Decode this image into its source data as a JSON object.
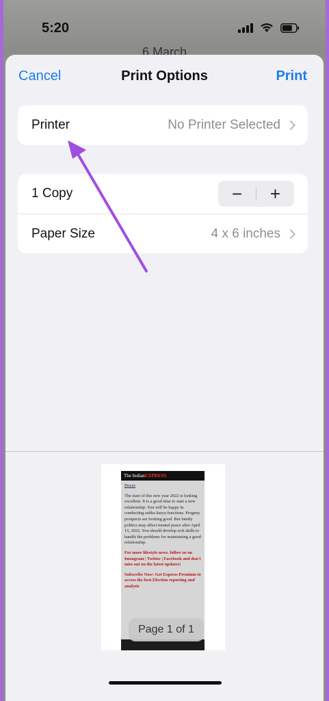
{
  "status_bar": {
    "time": "5:20"
  },
  "background_text": "6 March",
  "nav": {
    "cancel": "Cancel",
    "title": "Print Options",
    "print": "Print"
  },
  "printer_row": {
    "label": "Printer",
    "value": "No Printer Selected"
  },
  "copies_row": {
    "label": "1 Copy",
    "minus": "−",
    "plus": "+"
  },
  "paper_row": {
    "label": "Paper Size",
    "value": "4 x 6 inches"
  },
  "preview": {
    "brand_prefix": "The Indian",
    "brand_suffix": "EXPRESS",
    "link": "Pisces",
    "paragraph": "The start of this new year 2022 is looking excellent. It is a good time to start a new relationship. You will be happy in conducting subha karya functions. Progeny prospects are looking good. But family politics may affect mental peace after April 15, 2022. You should develop soft skills to handle the problems for maintaining a good relationship.",
    "promo": "For more lifestyle news, follow us on Instagram | Twitter | Facebook and don't miss out on the latest updates!",
    "subscribe": "Subscribe Now: Get Express Premium to access the best Election reporting and analysis",
    "page_badge": "Page 1 of 1"
  },
  "colors": {
    "accent": "#1a7cf0",
    "arrow": "#a04ee0",
    "sheet_bg": "#f1f1f5"
  }
}
